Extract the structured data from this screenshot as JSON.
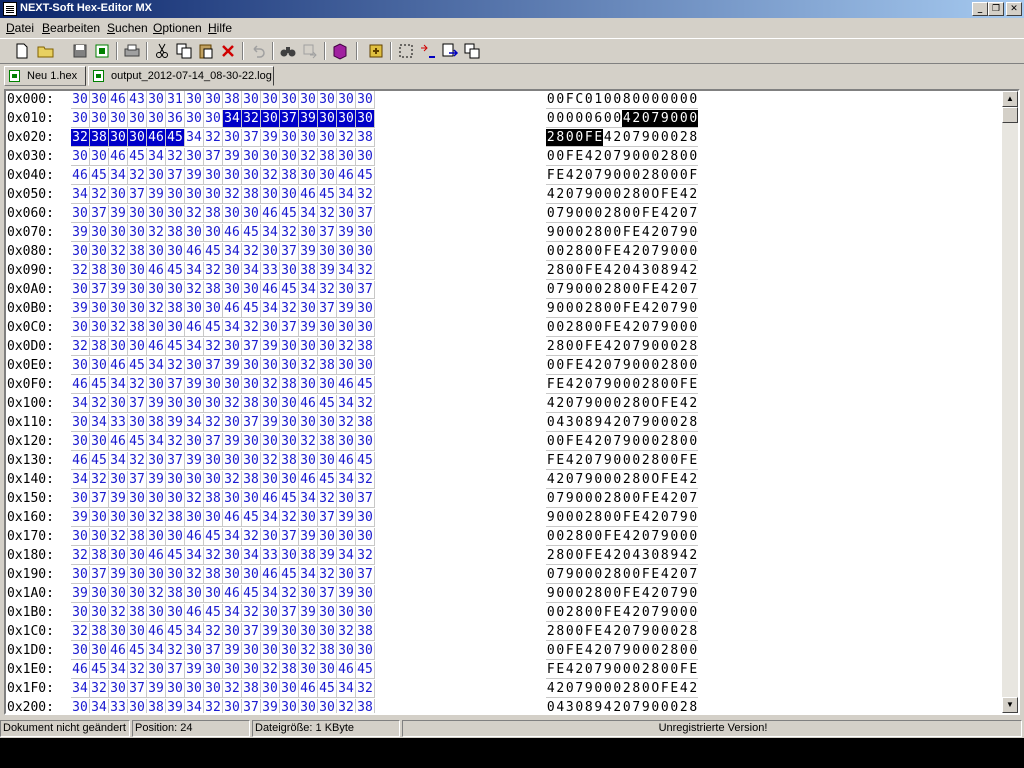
{
  "window": {
    "title": "NEXT-Soft Hex-Editor MX"
  },
  "title_buttons": {
    "minimize": "_",
    "restore": "❐",
    "close": "✕"
  },
  "menu": [
    "Datei",
    "Bearbeiten",
    "Suchen",
    "Optionen",
    "Hilfe"
  ],
  "toolbar_icons": [
    "new-file-icon",
    "open-folder-icon",
    "save-disk-icon",
    "excel-export-icon",
    "print-icon",
    "cut-icon",
    "copy-icon",
    "paste-icon",
    "delete-icon",
    "undo-icon",
    "find-binoculars-icon",
    "find-replace-icon",
    "book-icon",
    "settings-icon",
    "select-block-icon",
    "convert-abc-icon",
    "goto-icon",
    "copy-block-icon"
  ],
  "tabs": [
    {
      "label": "Neu 1.hex",
      "active": false
    },
    {
      "label": "output_2012-07-14_08-30-22.log",
      "active": true
    }
  ],
  "hex_rows": [
    {
      "addr": "0x000:",
      "hex": "30 30 46 43 30 31 30 30 38 30 30 30 30 30 30 30",
      "ascii": "00FC010080000000"
    },
    {
      "addr": "0x010:",
      "hex": "30 30 30 30 30 36 30 30 34 32 30 37 39 30 30 30",
      "ascii": "0000060042079000"
    },
    {
      "addr": "0x020:",
      "hex": "32 38 30 30 46 45 34 32 30 37 39 30 30 30 32 38",
      "ascii": "2800FE4207900028"
    },
    {
      "addr": "0x030:",
      "hex": "30 30 46 45 34 32 30 37 39 30 30 30 32 38 30 30",
      "ascii": "00FE420790002800"
    },
    {
      "addr": "0x040:",
      "hex": "46 45 34 32 30 37 39 30 30 30 32 38 30 30 46 45",
      "ascii": "FE4207900028000FE"
    },
    {
      "addr": "0x050:",
      "hex": "34 32 30 37 39 30 30 30 32 38 30 30 46 45 34 32",
      "ascii": "42079000280OFE42"
    },
    {
      "addr": "0x060:",
      "hex": "30 37 39 30 30 30 32 38 30 30 46 45 34 32 30 37",
      "ascii": "0790002800FE4207"
    },
    {
      "addr": "0x070:",
      "hex": "39 30 30 30 32 38 30 30 46 45 34 32 30 37 39 30",
      "ascii": "90002800FE420790"
    },
    {
      "addr": "0x080:",
      "hex": "30 30 32 38 30 30 46 45 34 32 30 37 39 30 30 30",
      "ascii": "002800FE42079000"
    },
    {
      "addr": "0x090:",
      "hex": "32 38 30 30 46 45 34 32 30 34 33 30 38 39 34 32",
      "ascii": "2800FE4204308942"
    },
    {
      "addr": "0x0A0:",
      "hex": "30 37 39 30 30 30 32 38 30 30 46 45 34 32 30 37",
      "ascii": "0790002800FE4207"
    },
    {
      "addr": "0x0B0:",
      "hex": "39 30 30 30 32 38 30 30 46 45 34 32 30 37 39 30",
      "ascii": "90002800FE420790"
    },
    {
      "addr": "0x0C0:",
      "hex": "30 30 32 38 30 30 46 45 34 32 30 37 39 30 30 30",
      "ascii": "002800FE42079000"
    },
    {
      "addr": "0x0D0:",
      "hex": "32 38 30 30 46 45 34 32 30 37 39 30 30 30 32 38",
      "ascii": "2800FE4207900028"
    },
    {
      "addr": "0x0E0:",
      "hex": "30 30 46 45 34 32 30 37 39 30 30 30 32 38 30 30",
      "ascii": "00FE420790002800"
    },
    {
      "addr": "0x0F0:",
      "hex": "46 45 34 32 30 37 39 30 30 30 32 38 30 30 46 45",
      "ascii": "FE420790002800FE"
    },
    {
      "addr": "0x100:",
      "hex": "34 32 30 37 39 30 30 30 32 38 30 30 46 45 34 32",
      "ascii": "42079000280OFE42"
    },
    {
      "addr": "0x110:",
      "hex": "30 34 33 30 38 39 34 32 30 37 39 30 30 30 32 38",
      "ascii": "0430894207900028"
    },
    {
      "addr": "0x120:",
      "hex": "30 30 46 45 34 32 30 37 39 30 30 30 32 38 30 30",
      "ascii": "00FE420790002800"
    },
    {
      "addr": "0x130:",
      "hex": "46 45 34 32 30 37 39 30 30 30 32 38 30 30 46 45",
      "ascii": "FE420790002800FE"
    },
    {
      "addr": "0x140:",
      "hex": "34 32 30 37 39 30 30 30 32 38 30 30 46 45 34 32",
      "ascii": "42079000280OFE42"
    },
    {
      "addr": "0x150:",
      "hex": "30 37 39 30 30 30 32 38 30 30 46 45 34 32 30 37",
      "ascii": "0790002800FE4207"
    },
    {
      "addr": "0x160:",
      "hex": "39 30 30 30 32 38 30 30 46 45 34 32 30 37 39 30",
      "ascii": "90002800FE420790"
    },
    {
      "addr": "0x170:",
      "hex": "30 30 32 38 30 30 46 45 34 32 30 37 39 30 30 30",
      "ascii": "002800FE42079000"
    },
    {
      "addr": "0x180:",
      "hex": "32 38 30 30 46 45 34 32 30 34 33 30 38 39 34 32",
      "ascii": "2800FE4204308942"
    },
    {
      "addr": "0x190:",
      "hex": "30 37 39 30 30 30 32 38 30 30 46 45 34 32 30 37",
      "ascii": "0790002800FE4207"
    },
    {
      "addr": "0x1A0:",
      "hex": "39 30 30 30 32 38 30 30 46 45 34 32 30 37 39 30",
      "ascii": "90002800FE420790"
    },
    {
      "addr": "0x1B0:",
      "hex": "30 30 32 38 30 30 46 45 34 32 30 37 39 30 30 30",
      "ascii": "002800FE42079000"
    },
    {
      "addr": "0x1C0:",
      "hex": "32 38 30 30 46 45 34 32 30 37 39 30 30 30 32 38",
      "ascii": "2800FE4207900028"
    },
    {
      "addr": "0x1D0:",
      "hex": "30 30 46 45 34 32 30 37 39 30 30 30 32 38 30 30",
      "ascii": "00FE420790002800"
    },
    {
      "addr": "0x1E0:",
      "hex": "46 45 34 32 30 37 39 30 30 30 32 38 30 30 46 45",
      "ascii": "FE420790002800FE"
    },
    {
      "addr": "0x1F0:",
      "hex": "34 32 30 37 39 30 30 30 32 38 30 30 46 45 34 32",
      "ascii": "42079000280OFE42"
    },
    {
      "addr": "0x200:",
      "hex": "30 34 33 30 38 39 34 32 30 37 39 30 30 30 32 38",
      "ascii": "0430894207900028"
    }
  ],
  "selection": {
    "start": 24,
    "end": 37,
    "cursor": 24
  },
  "colors": {
    "hex_text": "#1a1ad0",
    "selection_bg": "#0000c8",
    "ascii_selection_bg": "#000000",
    "title_start": "#0a246a",
    "title_end": "#a6caf0"
  },
  "scrollbar": {
    "up": "▲",
    "down": "▼"
  },
  "status": {
    "doc_state": "Dokument nicht geändert",
    "position": "Position: 24",
    "filesize": "Dateigröße: 1 KByte",
    "registration": "Unregistrierte Version!"
  }
}
